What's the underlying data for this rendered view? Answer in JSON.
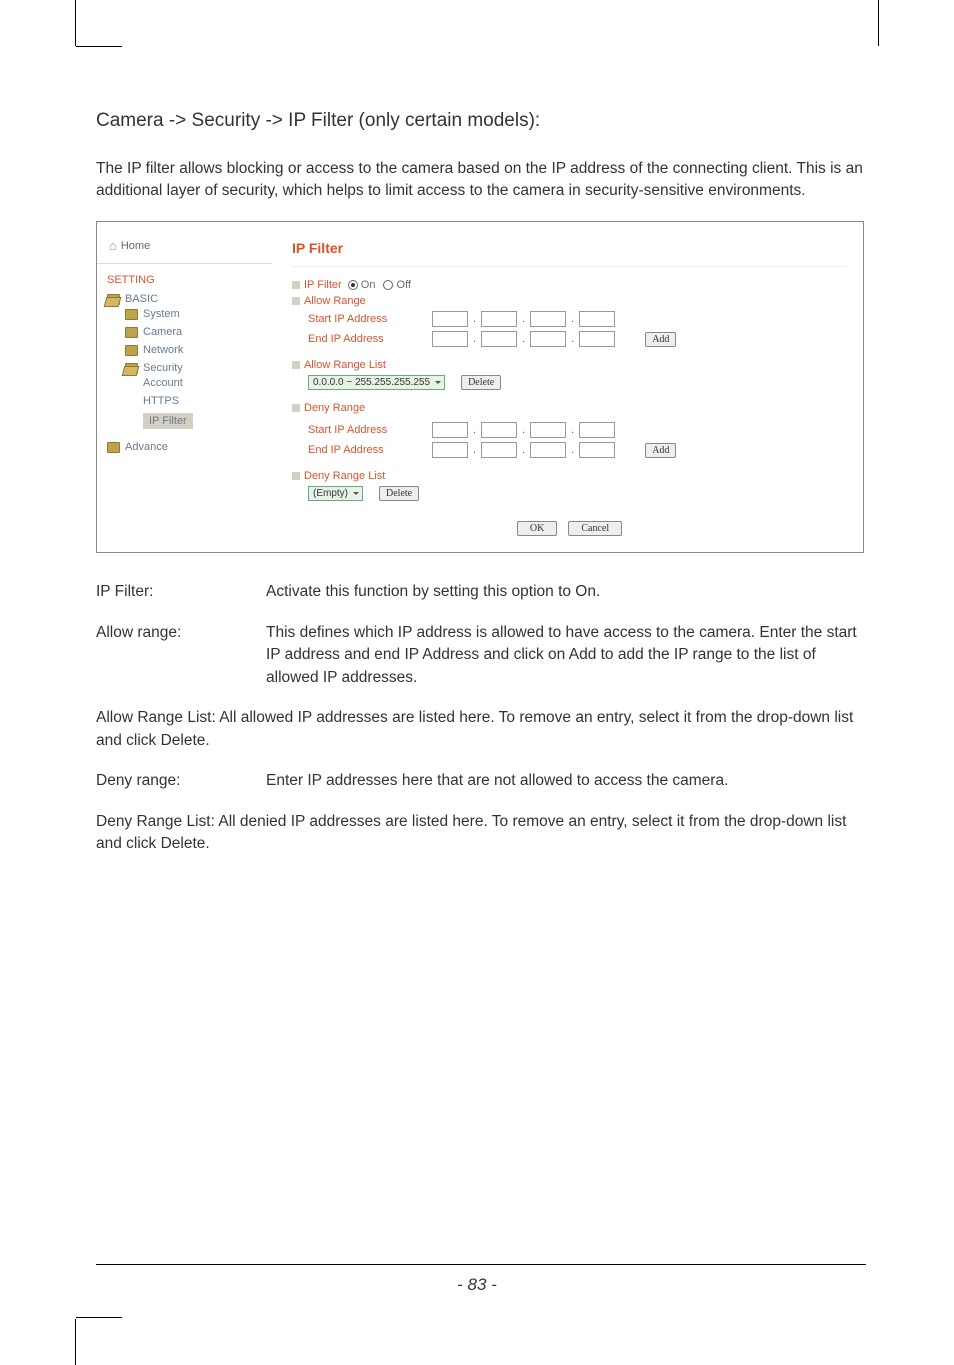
{
  "doc": {
    "title": "Camera -> Security -> IP Filter (only certain models):",
    "intro": "The IP filter allows blocking or access to the camera based on the IP address of the connecting client. This is an additional layer of security, which helps to limit access to the camera in security-sensitive environments.",
    "page_num": "- 83 -"
  },
  "sidebar": {
    "home": "Home",
    "setting": "SETTING",
    "basic": "BASIC",
    "system": "System",
    "camera": "Camera",
    "network": "Network",
    "security": "Security",
    "account": "Account",
    "https": "HTTPS",
    "ipfilter": "IP Filter",
    "advance": "Advance"
  },
  "panel": {
    "title": "IP Filter",
    "ipfilter_label": "IP Filter",
    "on": "On",
    "off": "Off",
    "allow_range": "Allow Range",
    "start_ip": "Start IP Address",
    "end_ip": "End IP Address",
    "add": "Add",
    "allow_range_list": "Allow Range List",
    "allow_select": "0.0.0.0 ~ 255.255.255.255",
    "delete": "Delete",
    "deny_range": "Deny Range",
    "deny_range_list": "Deny Range List",
    "deny_select": "(Empty)",
    "ok": "OK",
    "cancel": "Cancel"
  },
  "defs": {
    "ipfilter_term": "IP Filter:",
    "ipfilter_body": "Activate this function by setting this option to On.",
    "allow_term": "Allow range:",
    "allow_body": "This defines which IP address is allowed to have access to the camera. Enter the start IP address and end IP Address and click on Add to add the IP range to the list of allowed IP addresses.",
    "allowlist": "Allow Range List: All allowed IP addresses are listed here. To remove an entry, select it from the drop-down list and click Delete.",
    "deny_term": "Deny range:",
    "deny_body": "Enter IP addresses here that are not allowed to access the camera.",
    "denylist": "Deny Range List: All denied IP addresses are listed here. To remove an entry, select it from the drop-down list and click Delete."
  }
}
